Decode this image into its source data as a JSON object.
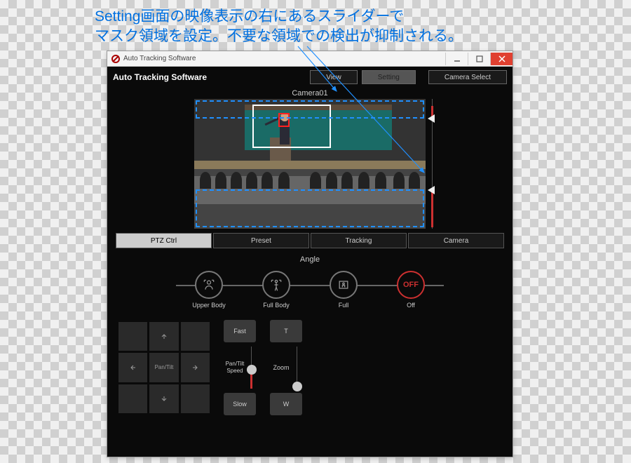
{
  "annotation": {
    "line1": "Setting画面の映像表示の右にあるスライダーで",
    "line2": "マスク領域を設定。不要な領域での検出が抑制される。"
  },
  "window": {
    "title": "Auto Tracking Software",
    "app_title": "Auto Tracking Software"
  },
  "nav": {
    "view": "View",
    "setting": "Setting",
    "camera_select": "Camera Select"
  },
  "camera": {
    "name": "Camera01"
  },
  "tabs": {
    "ptz": "PTZ Ctrl",
    "preset": "Preset",
    "tracking": "Tracking",
    "camera": "Camera"
  },
  "angle": {
    "section": "Angle",
    "upper": "Upper Body",
    "fullbody": "Full Body",
    "full": "Full",
    "off": "Off",
    "off_btn": "OFF"
  },
  "dpad": {
    "center": "Pan/Tilt"
  },
  "speed": {
    "fast": "Fast",
    "slow": "Slow",
    "label": "Pan/Tilt\nSpeed"
  },
  "zoom": {
    "t": "T",
    "w": "W",
    "label": "Zoom"
  }
}
